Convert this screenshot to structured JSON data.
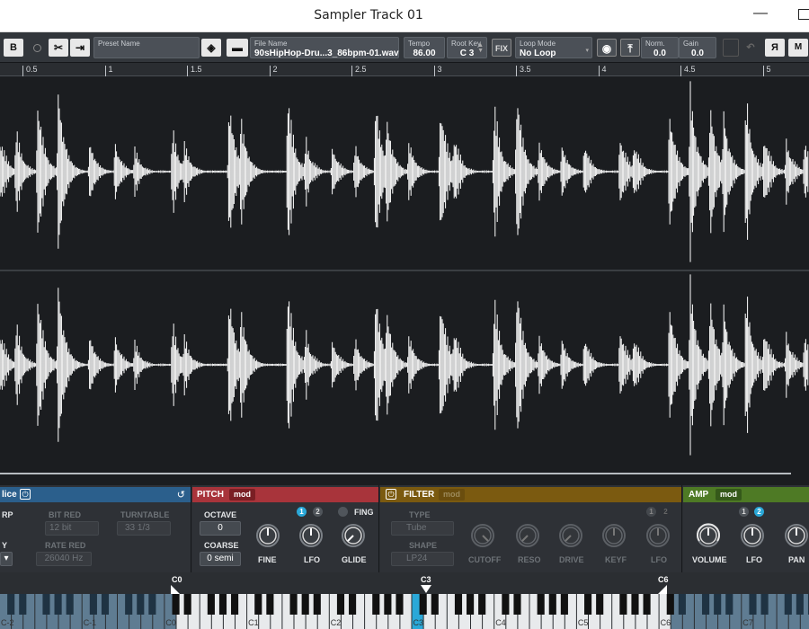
{
  "window": {
    "title": "Sampler Track 01"
  },
  "toolbar": {
    "b_button": "B",
    "preset_label": "Preset Name",
    "preset_value": "",
    "file_label": "File Name",
    "file_value": "90sHipHop-Dru...3_86bpm-01.wav",
    "tempo_label": "Tempo",
    "tempo_value": "86.00",
    "rootkey_label": "Root Key",
    "rootkey_value": "C 3",
    "fix_label": "FIX",
    "loop_label": "Loop Mode",
    "loop_value": "No Loop",
    "norm_label": "Norm.",
    "norm_value": "0.0",
    "gain_label": "Gain",
    "gain_value": "0.0",
    "reverse_label": "Я",
    "m_label": "M"
  },
  "ruler": {
    "marks": [
      "0.5",
      "1",
      "1.5",
      "2",
      "2.5",
      "3",
      "3.5",
      "4",
      "4.5",
      "5"
    ]
  },
  "panels": {
    "slice": {
      "title": "lice",
      "rp_label": "RP",
      "y_label": "Y",
      "bitred_label": "BIT RED",
      "bitred_value": "12 bit",
      "turntable_label": "TURNTABLE",
      "turntable_value": "33 1/3",
      "raterred_label": "RATE RED",
      "raterred_value": "26040 Hz"
    },
    "pitch": {
      "title": "PITCH",
      "mod": "mod",
      "octave_label": "OCTAVE",
      "octave_value": "0",
      "coarse_label": "COARSE",
      "coarse_value": "0 semi",
      "fine_label": "FINE",
      "lfo_label": "LFO",
      "glide_label": "GLIDE",
      "fing_label": "FING",
      "badge1": "1",
      "badge2": "2"
    },
    "filter": {
      "title": "FILTER",
      "mod": "mod",
      "type_label": "TYPE",
      "type_value": "Tube",
      "shape_label": "SHAPE",
      "shape_value": "LP24",
      "cutoff_label": "CUTOFF",
      "reso_label": "RESO",
      "drive_label": "DRIVE",
      "keyf_label": "KEYF",
      "lfo_label": "LFO",
      "badge1": "1",
      "badge2": "2"
    },
    "amp": {
      "title": "AMP",
      "mod": "mod",
      "volume_label": "VOLUME",
      "lfo_label": "LFO",
      "pan_label": "PAN",
      "badge1": "1",
      "badge2": "2"
    }
  },
  "keyboard": {
    "range_low": "C0",
    "root": "C3",
    "range_high": "C6",
    "octaves": [
      "C-2",
      "C-1",
      "C0",
      "C1",
      "C2",
      "C3",
      "C4",
      "C5",
      "C6",
      "C7"
    ]
  },
  "colors": {
    "slice": "#2b5f8c",
    "pitch": "#a8343b",
    "filter": "#7b5a10",
    "amp": "#4e7a25",
    "accent": "#2aa8d8"
  }
}
